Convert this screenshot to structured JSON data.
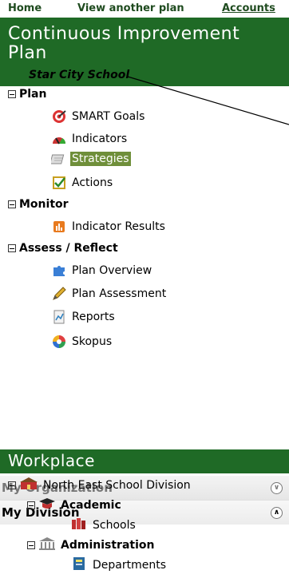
{
  "nav": {
    "home": "Home",
    "view_another": "View another plan",
    "accounts": "Accounts"
  },
  "plan": {
    "title_line1": "Continuous Improvement",
    "title_line2": "Plan",
    "school": "Star City School"
  },
  "sections": {
    "plan": {
      "label": "Plan",
      "items": [
        "SMART Goals",
        "Indicators",
        "Strategies",
        "Actions"
      ]
    },
    "monitor": {
      "label": "Monitor",
      "items": [
        "Indicator Results"
      ]
    },
    "assess": {
      "label": "Assess / Reflect",
      "items": [
        "Plan Overview",
        "Plan Assessment",
        "Reports",
        "Skopus"
      ]
    }
  },
  "selected_item": "Strategies",
  "workplace": {
    "title": "Workplace",
    "my_organization": "My Organization",
    "my_division": "My Division",
    "tree": {
      "root": "North East School Division",
      "academic": "Academic",
      "schools": "Schools",
      "administration": "Administration",
      "departments": "Departments"
    }
  },
  "icons": {
    "smart_goals": "target-icon",
    "indicators": "gauge-icon",
    "strategies": "notepad-icon",
    "actions": "checklist-icon",
    "indicator_results": "results-icon",
    "plan_overview": "puzzle-icon",
    "plan_assessment": "pen-icon",
    "reports": "report-icon",
    "skopus": "cycle-icon",
    "org_root": "building-icon",
    "academic": "graduation-icon",
    "schools": "books-icon",
    "administration": "columns-icon",
    "departments": "ledger-icon"
  },
  "colors": {
    "green": "#1f6a26",
    "selected": "#6f8f3a",
    "nav_text": "#1f4b1f"
  }
}
